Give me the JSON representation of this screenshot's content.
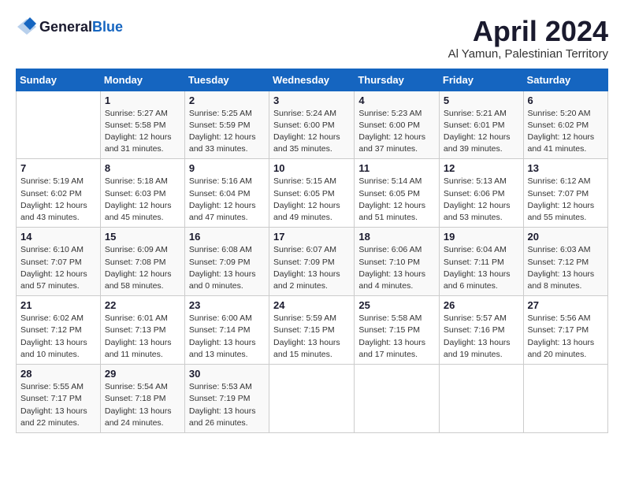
{
  "header": {
    "logo_general": "General",
    "logo_blue": "Blue",
    "title": "April 2024",
    "location": "Al Yamun, Palestinian Territory"
  },
  "calendar": {
    "days_of_week": [
      "Sunday",
      "Monday",
      "Tuesday",
      "Wednesday",
      "Thursday",
      "Friday",
      "Saturday"
    ],
    "weeks": [
      [
        {
          "date": "",
          "info": ""
        },
        {
          "date": "1",
          "info": "Sunrise: 5:27 AM\nSunset: 5:58 PM\nDaylight: 12 hours\nand 31 minutes."
        },
        {
          "date": "2",
          "info": "Sunrise: 5:25 AM\nSunset: 5:59 PM\nDaylight: 12 hours\nand 33 minutes."
        },
        {
          "date": "3",
          "info": "Sunrise: 5:24 AM\nSunset: 6:00 PM\nDaylight: 12 hours\nand 35 minutes."
        },
        {
          "date": "4",
          "info": "Sunrise: 5:23 AM\nSunset: 6:00 PM\nDaylight: 12 hours\nand 37 minutes."
        },
        {
          "date": "5",
          "info": "Sunrise: 5:21 AM\nSunset: 6:01 PM\nDaylight: 12 hours\nand 39 minutes."
        },
        {
          "date": "6",
          "info": "Sunrise: 5:20 AM\nSunset: 6:02 PM\nDaylight: 12 hours\nand 41 minutes."
        }
      ],
      [
        {
          "date": "7",
          "info": "Sunrise: 5:19 AM\nSunset: 6:02 PM\nDaylight: 12 hours\nand 43 minutes."
        },
        {
          "date": "8",
          "info": "Sunrise: 5:18 AM\nSunset: 6:03 PM\nDaylight: 12 hours\nand 45 minutes."
        },
        {
          "date": "9",
          "info": "Sunrise: 5:16 AM\nSunset: 6:04 PM\nDaylight: 12 hours\nand 47 minutes."
        },
        {
          "date": "10",
          "info": "Sunrise: 5:15 AM\nSunset: 6:05 PM\nDaylight: 12 hours\nand 49 minutes."
        },
        {
          "date": "11",
          "info": "Sunrise: 5:14 AM\nSunset: 6:05 PM\nDaylight: 12 hours\nand 51 minutes."
        },
        {
          "date": "12",
          "info": "Sunrise: 5:13 AM\nSunset: 6:06 PM\nDaylight: 12 hours\nand 53 minutes."
        },
        {
          "date": "13",
          "info": "Sunrise: 6:12 AM\nSunset: 7:07 PM\nDaylight: 12 hours\nand 55 minutes."
        }
      ],
      [
        {
          "date": "14",
          "info": "Sunrise: 6:10 AM\nSunset: 7:07 PM\nDaylight: 12 hours\nand 57 minutes."
        },
        {
          "date": "15",
          "info": "Sunrise: 6:09 AM\nSunset: 7:08 PM\nDaylight: 12 hours\nand 58 minutes."
        },
        {
          "date": "16",
          "info": "Sunrise: 6:08 AM\nSunset: 7:09 PM\nDaylight: 13 hours\nand 0 minutes."
        },
        {
          "date": "17",
          "info": "Sunrise: 6:07 AM\nSunset: 7:09 PM\nDaylight: 13 hours\nand 2 minutes."
        },
        {
          "date": "18",
          "info": "Sunrise: 6:06 AM\nSunset: 7:10 PM\nDaylight: 13 hours\nand 4 minutes."
        },
        {
          "date": "19",
          "info": "Sunrise: 6:04 AM\nSunset: 7:11 PM\nDaylight: 13 hours\nand 6 minutes."
        },
        {
          "date": "20",
          "info": "Sunrise: 6:03 AM\nSunset: 7:12 PM\nDaylight: 13 hours\nand 8 minutes."
        }
      ],
      [
        {
          "date": "21",
          "info": "Sunrise: 6:02 AM\nSunset: 7:12 PM\nDaylight: 13 hours\nand 10 minutes."
        },
        {
          "date": "22",
          "info": "Sunrise: 6:01 AM\nSunset: 7:13 PM\nDaylight: 13 hours\nand 11 minutes."
        },
        {
          "date": "23",
          "info": "Sunrise: 6:00 AM\nSunset: 7:14 PM\nDaylight: 13 hours\nand 13 minutes."
        },
        {
          "date": "24",
          "info": "Sunrise: 5:59 AM\nSunset: 7:15 PM\nDaylight: 13 hours\nand 15 minutes."
        },
        {
          "date": "25",
          "info": "Sunrise: 5:58 AM\nSunset: 7:15 PM\nDaylight: 13 hours\nand 17 minutes."
        },
        {
          "date": "26",
          "info": "Sunrise: 5:57 AM\nSunset: 7:16 PM\nDaylight: 13 hours\nand 19 minutes."
        },
        {
          "date": "27",
          "info": "Sunrise: 5:56 AM\nSunset: 7:17 PM\nDaylight: 13 hours\nand 20 minutes."
        }
      ],
      [
        {
          "date": "28",
          "info": "Sunrise: 5:55 AM\nSunset: 7:17 PM\nDaylight: 13 hours\nand 22 minutes."
        },
        {
          "date": "29",
          "info": "Sunrise: 5:54 AM\nSunset: 7:18 PM\nDaylight: 13 hours\nand 24 minutes."
        },
        {
          "date": "30",
          "info": "Sunrise: 5:53 AM\nSunset: 7:19 PM\nDaylight: 13 hours\nand 26 minutes."
        },
        {
          "date": "",
          "info": ""
        },
        {
          "date": "",
          "info": ""
        },
        {
          "date": "",
          "info": ""
        },
        {
          "date": "",
          "info": ""
        }
      ]
    ]
  }
}
